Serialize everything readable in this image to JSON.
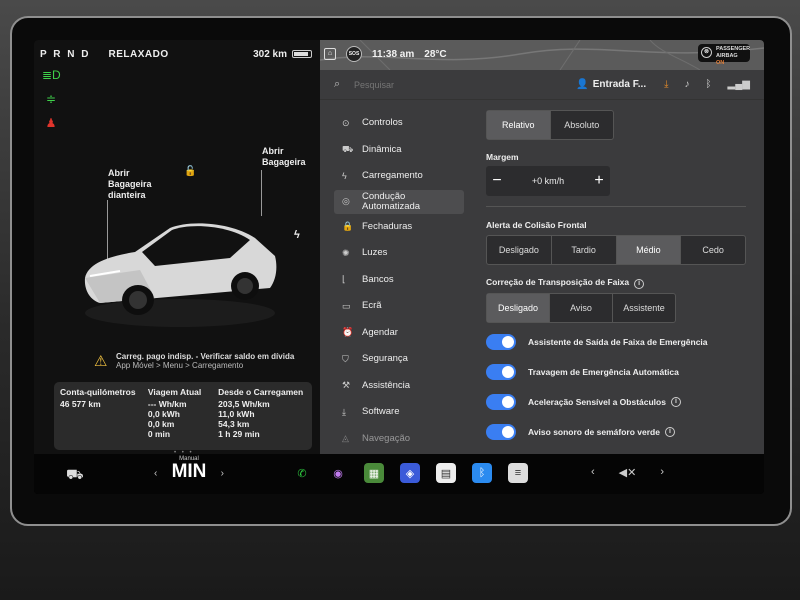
{
  "car_status": {
    "gear": "P R N D",
    "drive_mode": "RELAXADO",
    "range": "302 km",
    "battery_level": 0.8
  },
  "telltales": [
    {
      "icon": "headlight-icon",
      "color": "#3fd14a",
      "glyph": "≣D"
    },
    {
      "icon": "parking-light-icon",
      "color": "#3fd14a",
      "glyph": "≑"
    },
    {
      "icon": "seatbelt-warning-icon",
      "color": "#e0342c",
      "glyph": "♟"
    }
  ],
  "car_view": {
    "front_trunk": "Abrir\nBagageira\ndianteira",
    "rear_trunk": "Abrir\nBagageira"
  },
  "charge_alert": {
    "line1": "Carreg. pago indisp. - Verificar saldo em dívida",
    "line2": "App Móvel > Menu > Carregamento"
  },
  "trip": {
    "odometer_label": "Conta-quilómetros",
    "odometer_value": "46 577 km",
    "current_label": "Viagem Atual",
    "current_rate": "--- Wh/km",
    "current_energy": "0,0 kWh",
    "current_distance": "0,0 km",
    "current_time": "0 min",
    "since_charge_label": "Desde o Carregamen",
    "since_rate": "203,5 Wh/km",
    "since_energy": "11,0 kWh",
    "since_distance": "54,3 km",
    "since_time": "1 h 29 min"
  },
  "topstatus": {
    "sos": "SOS",
    "time": "11:38 am",
    "temperature": "28°C",
    "airbag_line1": "PASSENGER",
    "airbag_line2": "AIRBAG",
    "airbag_state": "ON"
  },
  "search": {
    "placeholder": "Pesquisar"
  },
  "profile": {
    "name": "Entrada F..."
  },
  "nav": [
    {
      "label": "Controlos",
      "icon": "toggle-icon",
      "glyph": "⊙"
    },
    {
      "label": "Dinâmica",
      "icon": "car-icon",
      "glyph": "⛟"
    },
    {
      "label": "Carregamento",
      "icon": "bolt-icon",
      "glyph": "ϟ"
    },
    {
      "label": "Condução\nAutomatizada",
      "icon": "steering-wheel-icon",
      "glyph": "◎",
      "active": true
    },
    {
      "label": "Fechaduras",
      "icon": "lock-icon",
      "glyph": "🔒"
    },
    {
      "label": "Luzes",
      "icon": "sun-icon",
      "glyph": "✺"
    },
    {
      "label": "Bancos",
      "icon": "seat-icon",
      "glyph": "⌊"
    },
    {
      "label": "Ecrã",
      "icon": "display-icon",
      "glyph": "▭"
    },
    {
      "label": "Agendar",
      "icon": "alarm-clock-icon",
      "glyph": "⏰"
    },
    {
      "label": "Segurança",
      "icon": "shield-icon",
      "glyph": "⛉"
    },
    {
      "label": "Assistência",
      "icon": "wrench-icon",
      "glyph": "⚒"
    },
    {
      "label": "Software",
      "icon": "download-icon",
      "glyph": "⤓"
    },
    {
      "label": "Navegação",
      "icon": "navigation-icon",
      "glyph": "◬",
      "faded": true
    }
  ],
  "speed_mode": {
    "options": [
      "Relativo",
      "Absoluto"
    ],
    "selected": 0
  },
  "margin": {
    "label": "Margem",
    "value": "+0 km/h",
    "minus": "−",
    "plus": "+"
  },
  "fcw": {
    "label": "Alerta de Colisão Frontal",
    "options": [
      "Desligado",
      "Tardio",
      "Médio",
      "Cedo"
    ],
    "selected": 2
  },
  "lane": {
    "label": "Correção de Transposição de Faixa",
    "options": [
      "Desligado",
      "Aviso",
      "Assistente"
    ],
    "selected": 0
  },
  "toggles": [
    {
      "label": "Assistente de Saída de Faixa de Emergência",
      "info": false,
      "on": true
    },
    {
      "label": "Travagem de Emergência Automática",
      "info": false,
      "on": true
    },
    {
      "label": "Aceleração Sensível a Obstáculos",
      "info": true,
      "on": true
    },
    {
      "label": "Aviso sonoro de semáforo verde",
      "info": true,
      "on": true
    }
  ],
  "dock": {
    "gear_mode": "Manual",
    "gear_value": "MIN",
    "apps": [
      {
        "name": "phone-app-icon",
        "glyph": "✆",
        "color": "#2ecc40",
        "bg": "transparent"
      },
      {
        "name": "camera-app-icon",
        "glyph": "◉",
        "color": "#c27bf0",
        "bg": "transparent"
      },
      {
        "name": "toybox-app-icon",
        "glyph": "▦",
        "color": "#fff",
        "bg": "#4a8a3a"
      },
      {
        "name": "navigation-app-icon",
        "glyph": "◈",
        "color": "#fff",
        "bg": "#3b5bd9"
      },
      {
        "name": "calendar-app-icon",
        "glyph": "▤",
        "color": "#333",
        "bg": "#eee"
      },
      {
        "name": "bluetooth-app-icon",
        "glyph": "ᛒ",
        "color": "#fff",
        "bg": "#2b8bf0"
      },
      {
        "name": "dashcam-app-icon",
        "glyph": "≡",
        "color": "#333",
        "bg": "#ddd"
      }
    ],
    "volume": "◁✕"
  }
}
